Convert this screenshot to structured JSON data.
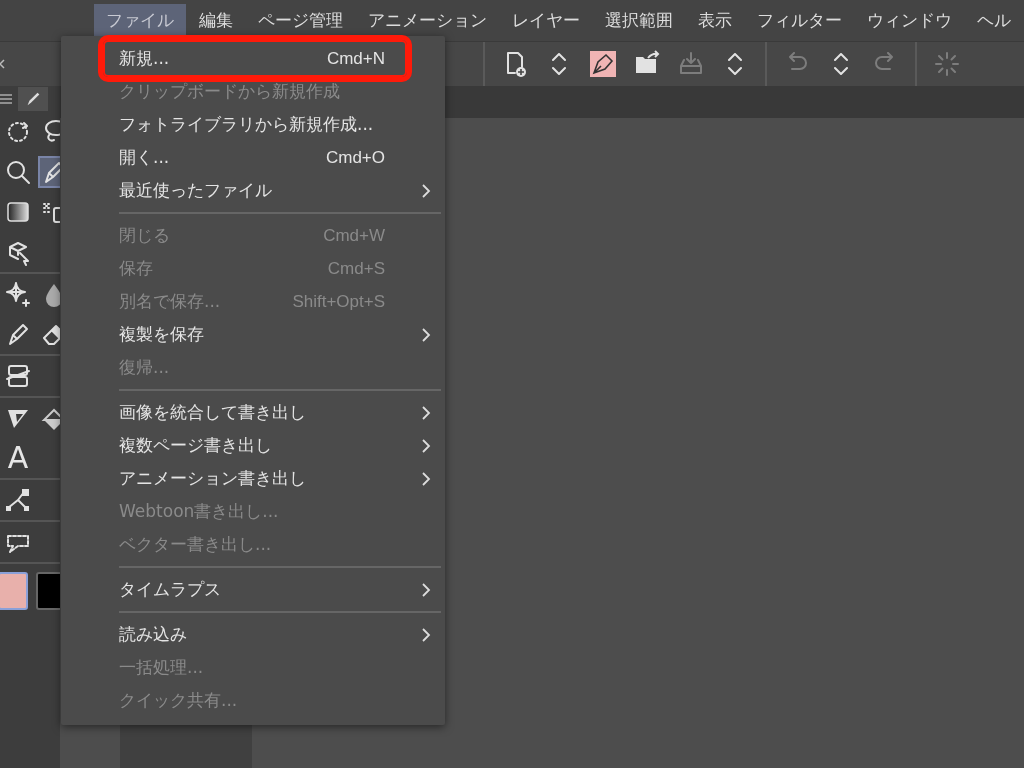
{
  "menubar": {
    "items": [
      {
        "label": "ファイル",
        "selected": true
      },
      {
        "label": "編集",
        "selected": false
      },
      {
        "label": "ページ管理",
        "selected": false
      },
      {
        "label": "アニメーション",
        "selected": false
      },
      {
        "label": "レイヤー",
        "selected": false
      },
      {
        "label": "選択範囲",
        "selected": false
      },
      {
        "label": "表示",
        "selected": false
      },
      {
        "label": "フィルター",
        "selected": false
      },
      {
        "label": "ウィンドウ",
        "selected": false
      },
      {
        "label": "ヘル",
        "selected": false
      }
    ]
  },
  "toolbar": [
    {
      "kind": "divider"
    },
    {
      "kind": "page-add",
      "disabled": false
    },
    {
      "kind": "updown",
      "disabled": false
    },
    {
      "kind": "pen-nib",
      "disabled": false
    },
    {
      "kind": "folder",
      "disabled": false
    },
    {
      "kind": "tray",
      "disabled": true
    },
    {
      "kind": "updown",
      "disabled": false
    },
    {
      "kind": "divider"
    },
    {
      "kind": "undo",
      "disabled": true
    },
    {
      "kind": "updown",
      "disabled": false
    },
    {
      "kind": "redo",
      "disabled": true
    },
    {
      "kind": "divider"
    },
    {
      "kind": "spinner",
      "disabled": true
    }
  ],
  "tool_palette": {
    "groups": [
      {
        "tools": [
          {
            "kind": "rotate",
            "selected": false
          },
          {
            "kind": "lasso",
            "selected": false
          },
          {
            "kind": "zoom",
            "selected": false
          },
          {
            "kind": "pen",
            "selected": true
          },
          {
            "kind": "gradient",
            "selected": false
          },
          {
            "kind": "spray",
            "selected": false
          },
          {
            "kind": "box",
            "selected": false
          }
        ]
      },
      {
        "tools": [
          {
            "kind": "sparkle",
            "selected": false
          },
          {
            "kind": "drop",
            "selected": false
          },
          {
            "kind": "pen",
            "selected": false
          },
          {
            "kind": "eraser",
            "selected": false
          }
        ]
      },
      {
        "tools": [
          {
            "kind": "layer",
            "selected": false
          }
        ]
      },
      {
        "tools": [
          {
            "kind": "ruler",
            "selected": false
          },
          {
            "kind": "fill",
            "selected": false
          },
          {
            "kind": "text",
            "glyph": "A",
            "selected": false
          }
        ]
      },
      {
        "tools": [
          {
            "kind": "vector",
            "selected": false
          }
        ]
      },
      {
        "tools": [
          {
            "kind": "balloon",
            "selected": false
          }
        ]
      }
    ],
    "colors": [
      {
        "color": "#e8b0ab",
        "selected": true
      },
      {
        "color": "#000000",
        "selected": false
      }
    ]
  },
  "file_menu": {
    "items": [
      {
        "kind": "item",
        "label": "新規...",
        "shortcut": "Cmd+N",
        "submenu": false,
        "disabled": false,
        "highlighted": true
      },
      {
        "kind": "item",
        "label": "クリップボードから新規作成",
        "submenu": false,
        "disabled": true,
        "highlighted": false
      },
      {
        "kind": "item",
        "label": "フォトライブラリから新規作成...",
        "submenu": false,
        "disabled": false,
        "highlighted": false
      },
      {
        "kind": "item",
        "label": "開く...",
        "shortcut": "Cmd+O",
        "submenu": false,
        "disabled": false,
        "highlighted": false
      },
      {
        "kind": "item",
        "label": "最近使ったファイル",
        "submenu": true,
        "disabled": false,
        "highlighted": false
      },
      {
        "kind": "separator"
      },
      {
        "kind": "item",
        "label": "閉じる",
        "shortcut": "Cmd+W",
        "submenu": false,
        "disabled": true,
        "highlighted": false
      },
      {
        "kind": "item",
        "label": "保存",
        "shortcut": "Cmd+S",
        "submenu": false,
        "disabled": true,
        "highlighted": false
      },
      {
        "kind": "item",
        "label": "別名で保存...",
        "shortcut": "Shift+Opt+S",
        "submenu": false,
        "disabled": true,
        "highlighted": false
      },
      {
        "kind": "item",
        "label": "複製を保存",
        "submenu": true,
        "disabled": false,
        "highlighted": false
      },
      {
        "kind": "item",
        "label": "復帰...",
        "submenu": false,
        "disabled": true,
        "highlighted": false
      },
      {
        "kind": "separator"
      },
      {
        "kind": "item",
        "label": "画像を統合して書き出し",
        "submenu": true,
        "disabled": false,
        "highlighted": false
      },
      {
        "kind": "item",
        "label": "複数ページ書き出し",
        "submenu": true,
        "disabled": false,
        "highlighted": false
      },
      {
        "kind": "item",
        "label": "アニメーション書き出し",
        "submenu": true,
        "disabled": false,
        "highlighted": false
      },
      {
        "kind": "item",
        "label": "Webtoon書き出し...",
        "submenu": false,
        "disabled": true,
        "highlighted": false
      },
      {
        "kind": "item",
        "label": "ベクター書き出し...",
        "submenu": false,
        "disabled": true,
        "highlighted": false
      },
      {
        "kind": "separator"
      },
      {
        "kind": "item",
        "label": "タイムラプス",
        "submenu": true,
        "disabled": false,
        "highlighted": false
      },
      {
        "kind": "separator"
      },
      {
        "kind": "item",
        "label": "読み込み",
        "submenu": true,
        "disabled": false,
        "highlighted": false
      },
      {
        "kind": "item",
        "label": "一括処理...",
        "submenu": false,
        "disabled": true,
        "highlighted": false
      },
      {
        "kind": "item",
        "label": "クイック共有...",
        "submenu": false,
        "disabled": true,
        "highlighted": false
      }
    ]
  }
}
